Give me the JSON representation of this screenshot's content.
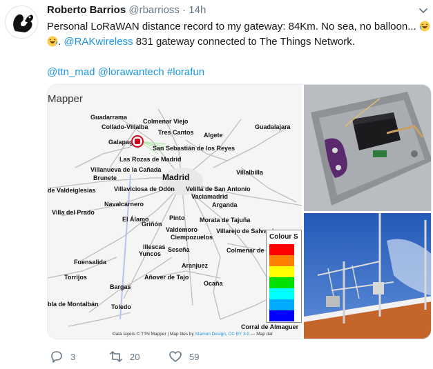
{
  "tweet": {
    "author_name": "Roberto Barrios",
    "author_handle": "@rbarrioss",
    "separator": "·",
    "time": "14h",
    "text_line1": "Personal LoRaWAN distance record to my gateway: 84Km. No sea, no balloon...",
    "mention_rak": "@RAKwireless",
    "text_line2_rest": " 831 gateway connected to The Things Network.",
    "hashtags": {
      "ttn": "@ttn_mad",
      "lorawantech": "@lorawantech",
      "lorafun": "#lorafun"
    }
  },
  "media": {
    "map": {
      "title": "Mapper",
      "places": [
        {
          "name": "Guadarrama"
        },
        {
          "name": "Colmenar Viejo"
        },
        {
          "name": "Collado-Villalba"
        },
        {
          "name": "Tres Cantos"
        },
        {
          "name": "Guadalajara"
        },
        {
          "name": "Algete"
        },
        {
          "name": "Galapagar"
        },
        {
          "name": "San Sebastián de los Reyes"
        },
        {
          "name": "Las Rozas de Madrid"
        },
        {
          "name": "Villanueva de la Cañada"
        },
        {
          "name": "Madrid"
        },
        {
          "name": "Villalbilla"
        },
        {
          "name": "Brunete"
        },
        {
          "name": "de Valdeiglesias"
        },
        {
          "name": "Villaviciosa de Odón"
        },
        {
          "name": "Velilla de San Antonio"
        },
        {
          "name": "Vaciamadrid"
        },
        {
          "name": "Navalcarnero"
        },
        {
          "name": "Arganda"
        },
        {
          "name": "Villa del Prado"
        },
        {
          "name": "El Álamo"
        },
        {
          "name": "Pinto"
        },
        {
          "name": "Morata de Tajuña"
        },
        {
          "name": "Griñón"
        },
        {
          "name": "Valdemoro"
        },
        {
          "name": "Villarejo de Salvanés"
        },
        {
          "name": "Ciempozuelos"
        },
        {
          "name": "Illescas"
        },
        {
          "name": "Yuncos"
        },
        {
          "name": "Seseña"
        },
        {
          "name": "Colmenar de Oreja"
        },
        {
          "name": "Fuensalida"
        },
        {
          "name": "Aranjuez"
        },
        {
          "name": "Torrijos"
        },
        {
          "name": "Añover de Tajo"
        },
        {
          "name": "Bargas"
        },
        {
          "name": "Ocaña"
        },
        {
          "name": "bla de Montalbán"
        },
        {
          "name": "Toledo"
        },
        {
          "name": "Corral de Almaguer"
        }
      ],
      "legend": {
        "title": "Colour S",
        "colors": [
          "#ff0000",
          "#ff8000",
          "#ffff00",
          "#00e000",
          "#00ffff",
          "#00aaff",
          "#0000ff"
        ]
      },
      "attribution_pre": "Data layers © TTN Mapper | Map tiles by ",
      "attribution_link1": "Stamen Design",
      "attribution_mid": ", ",
      "attribution_link2": "CC BY 3.0",
      "attribution_post": " — Map dat"
    }
  },
  "actions": {
    "replies": "3",
    "retweets": "20",
    "likes": "59"
  },
  "icons": {
    "avatar": "squirrel-logo-icon",
    "menu": "chevron-down-icon",
    "reply": "reply-icon",
    "retweet": "retweet-icon",
    "like": "heart-icon",
    "emoji": "laughing-emoji-icon"
  },
  "colors": {
    "link": "#1b95e0",
    "muted": "#657786",
    "text": "#14171a",
    "gateway": "#d0021b"
  }
}
